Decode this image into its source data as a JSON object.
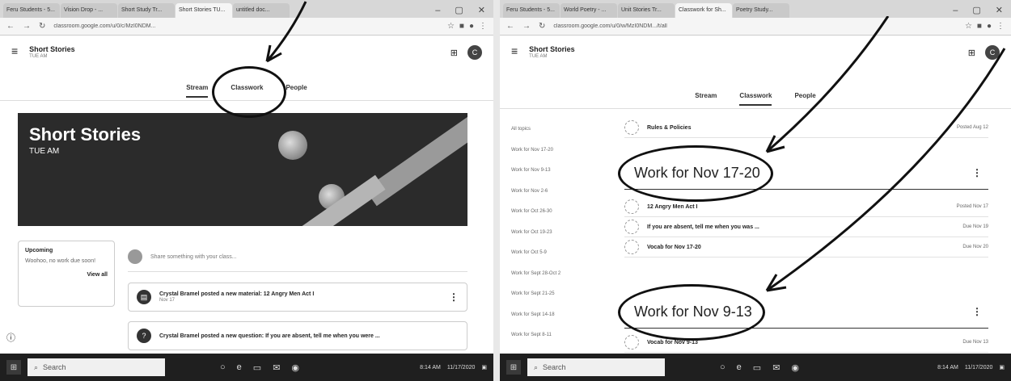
{
  "left": {
    "browser": {
      "tabs": [
        {
          "label": "Feru Students - 5..."
        },
        {
          "label": "Vision Drop - ..."
        },
        {
          "label": "Short Study Tr..."
        },
        {
          "label": "Short Stories TU..."
        },
        {
          "label": "untitled doc..."
        }
      ],
      "url": "classroom.google.com/u/0/c/MzI0NDM..."
    },
    "class": {
      "name": "Short Stories",
      "section": "TUE AM"
    },
    "avatar_initial": "C",
    "nav": {
      "stream": "Stream",
      "classwork": "Classwork",
      "people": "People"
    },
    "banner": {
      "title": "Short Stories",
      "subtitle": "TUE AM"
    },
    "upcoming": {
      "title": "Upcoming",
      "text": "Woohoo, no work due soon!",
      "link": "View all"
    },
    "announce_placeholder": "Share something with your class...",
    "posts": [
      {
        "text": "Crystal Bramel posted a new material: 12 Angry Men Act I",
        "date": "Nov 17"
      },
      {
        "text": "Crystal Bramel posted a new question: If you are absent, tell me when you were ...",
        "date": ""
      }
    ],
    "taskbar": {
      "search": "Search",
      "time": "8:14 AM",
      "date": "11/17/2020"
    }
  },
  "right": {
    "browser": {
      "tabs": [
        {
          "label": "Feru Students - 5..."
        },
        {
          "label": "World Poetry - ..."
        },
        {
          "label": "Unit Stories Tr..."
        },
        {
          "label": "Classwork for Sh..."
        },
        {
          "label": "Poetry Study..."
        }
      ],
      "url": "classroom.google.com/u/0/w/MzI0NDM.../t/all"
    },
    "class": {
      "name": "Short Stories",
      "section": "TUE AM"
    },
    "avatar_initial": "C",
    "nav": {
      "stream": "Stream",
      "classwork": "Classwork",
      "people": "People"
    },
    "topics": [
      "All topics",
      "Work for Nov 17-20",
      "Work for Nov 9-13",
      "Work for Nov 2-6",
      "Work for Oct 26-30",
      "Work for Oct 19-23",
      "Work for Oct 5-9",
      "Work for Sept 28-Oct 2",
      "Work for Sept 21-25",
      "Work for Sept 14-18",
      "Work for Sept 8-11"
    ],
    "top_item": {
      "title": "Rules & Policies",
      "due": "Posted Aug 12"
    },
    "section1": {
      "title": "Work for Nov 17-20",
      "items": [
        {
          "title": "12 Angry Men Act I",
          "due": "Posted Nov 17"
        },
        {
          "title": "If you are absent, tell me when you was ...",
          "due": "Due Nov 19"
        },
        {
          "title": "Vocab for Nov 17-20",
          "due": "Due Nov 20"
        }
      ]
    },
    "section2": {
      "title": "Work for Nov 9-13",
      "items": [
        {
          "title": "Vocab for Nov 9-13",
          "due": "Due Nov 13"
        }
      ]
    },
    "taskbar": {
      "search": "Search",
      "time": "8:14 AM",
      "date": "11/17/2020"
    }
  },
  "colors": {
    "taskbar": "#1f1f1f",
    "banner": "#2b2b2b",
    "annotation": "#111111"
  }
}
